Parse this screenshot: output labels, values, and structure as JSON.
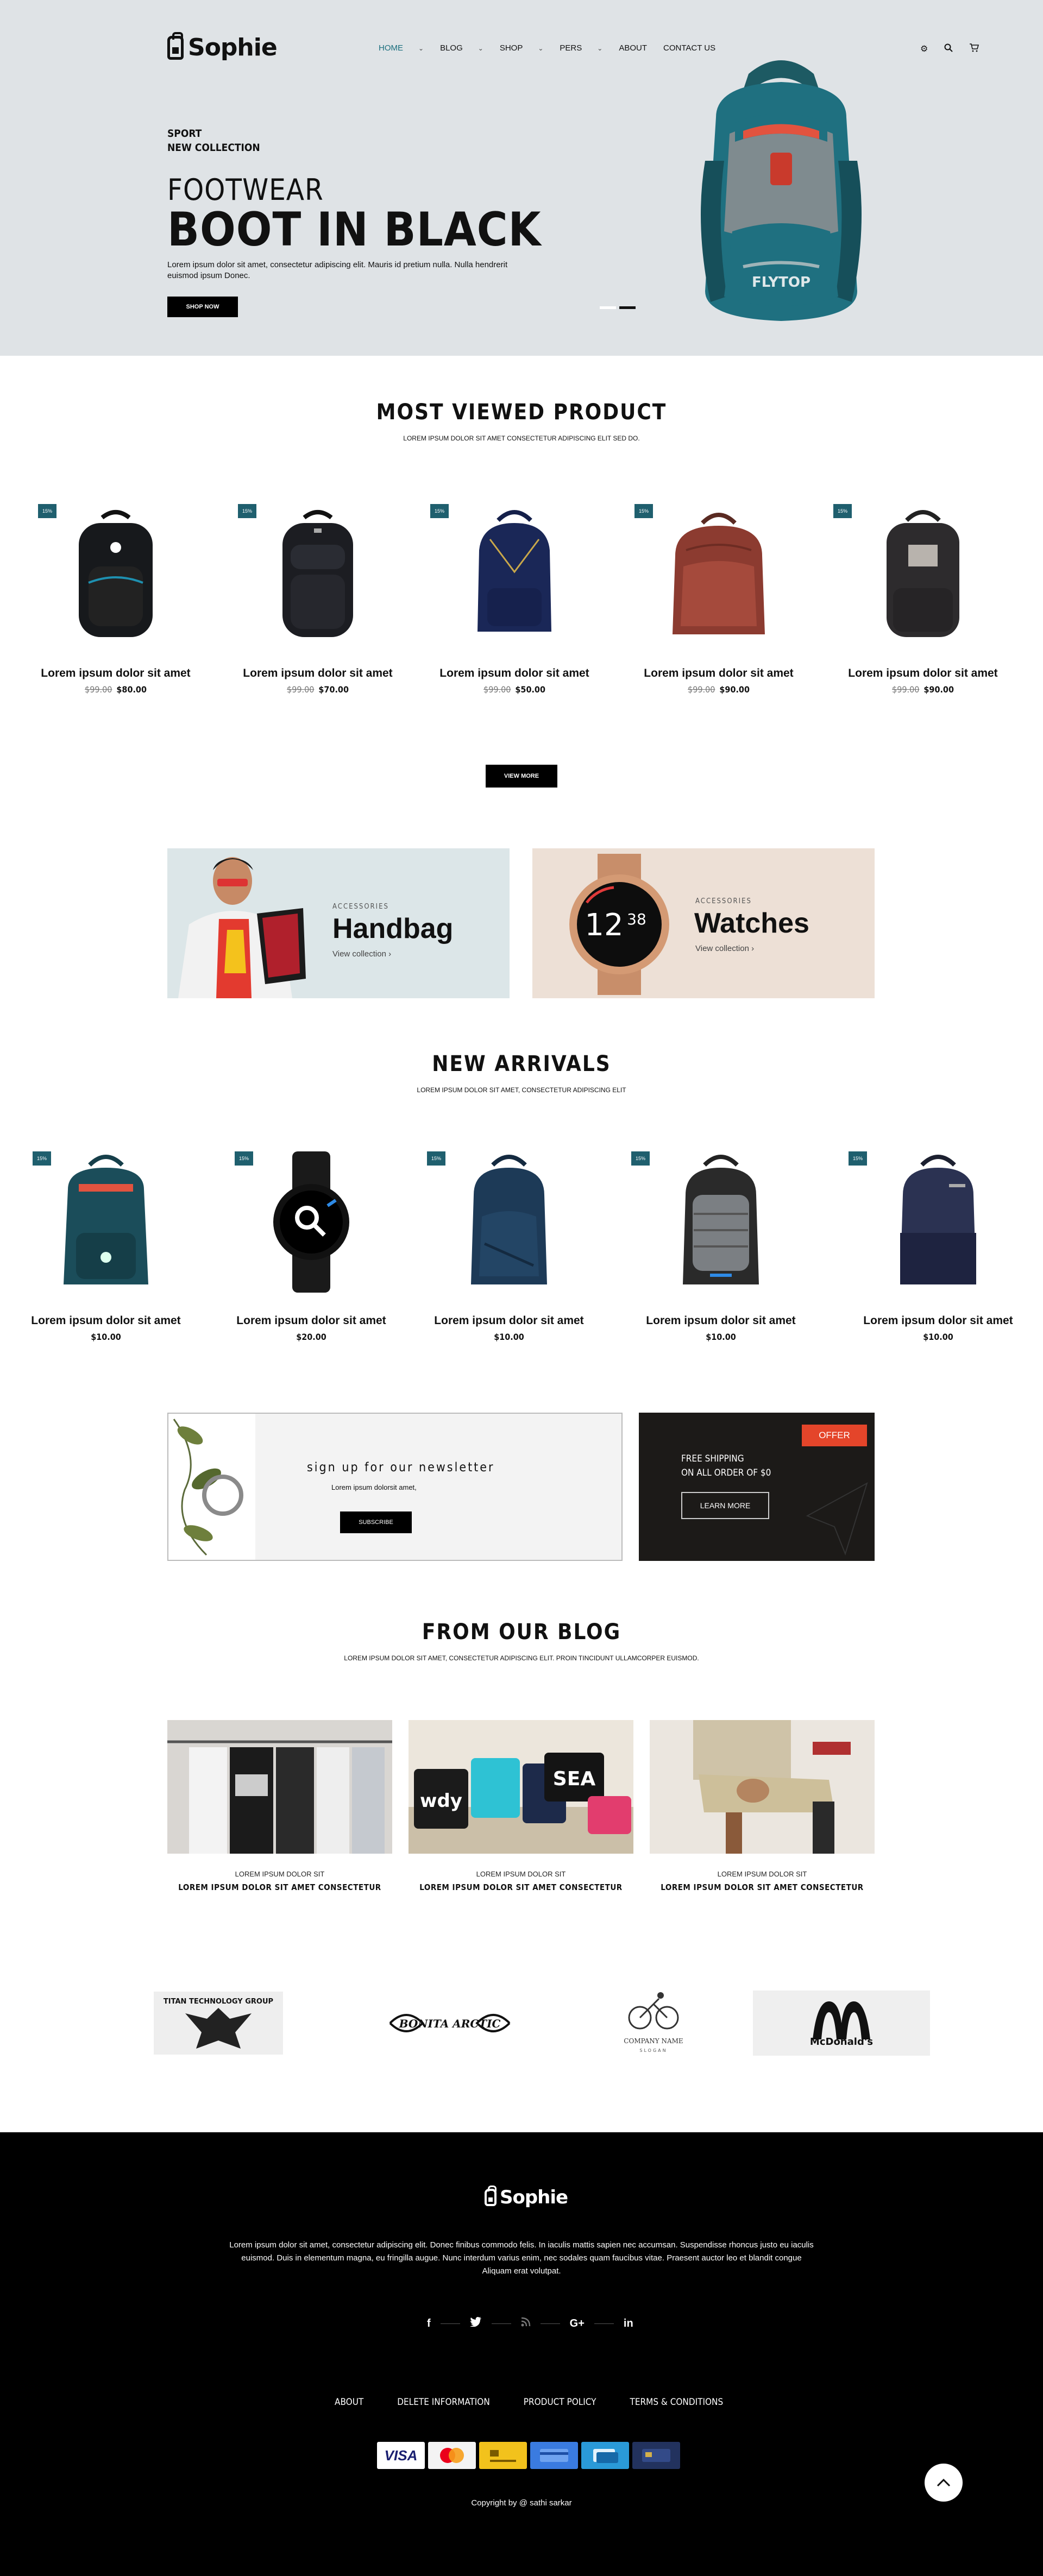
{
  "header": {
    "logo_text": "Sophie",
    "nav": [
      {
        "label": "Home",
        "active": true,
        "has_dropdown": true
      },
      {
        "label": "Blog",
        "has_dropdown": true
      },
      {
        "label": "Shop",
        "has_dropdown": true
      },
      {
        "label": "Pers",
        "has_dropdown": true
      },
      {
        "label": "About",
        "has_dropdown": false
      },
      {
        "label": "Contact Us",
        "has_dropdown": false
      }
    ],
    "icons": [
      "gear-icon",
      "search-icon",
      "cart-icon"
    ],
    "accent": "#1a6e7d"
  },
  "hero": {
    "sub1": "SPORT",
    "sub2": "NEW COLLECTION",
    "kicker": "FOOTWEAR",
    "title": "BOOT IN BLACK",
    "desc": "Lorem ipsum dolor sit amet, consectetur adipiscing elit. Mauris id pretium nulla. Nulla hendrerit euismod ipsum Donec.",
    "button": "SHOP NOW",
    "bag_brand": "FLYTOP",
    "slides": 2,
    "active_slide": 2
  },
  "most_viewed": {
    "title": "MOST  VIEWED PRODUCT",
    "subtitle": "LOREM IPSUM DOLOR SIT AMET CONSECTETUR ADIPISCING ELIT SED DO.",
    "products": [
      {
        "badge": "15%",
        "name": "Lorem ipsum dolor sit amet",
        "old": "$99.00",
        "price": "$80.00"
      },
      {
        "badge": "15%",
        "name": "Lorem ipsum dolor sit amet",
        "old": "$99.00",
        "price": "$70.00"
      },
      {
        "badge": "15%",
        "name": "Lorem ipsum dolor sit amet",
        "old": "$99.00",
        "price": "$50.00"
      },
      {
        "badge": "15%",
        "name": "Lorem ipsum dolor sit amet",
        "old": "$99.00",
        "price": "$90.00"
      },
      {
        "badge": "15%",
        "name": "Lorem ipsum dolor sit amet",
        "old": "$99.00",
        "price": "$90.00"
      }
    ],
    "view_more": "VIEW MORE"
  },
  "banners": [
    {
      "category": "ACCESSORIES",
      "title": "Handbag",
      "link": "View collection"
    },
    {
      "category": "ACCESSORIES",
      "title": "Watches",
      "link": "View collection",
      "watch_time": "12",
      "watch_min": "38"
    }
  ],
  "new_arrivals": {
    "title": "NEW ARRIVALS",
    "subtitle": "LOREM IPSUM DOLOR SIT AMET, CONSECTETUR ADIPISCING ELIT",
    "products": [
      {
        "badge": "15%",
        "name": "Lorem ipsum dolor sit amet",
        "price": "$10.00"
      },
      {
        "badge": "15%",
        "name": "Lorem ipsum dolor sit amet",
        "price": "$20.00"
      },
      {
        "badge": "15%",
        "name": "Lorem ipsum dolor sit amet",
        "price": "$10.00"
      },
      {
        "badge": "15%",
        "name": "Lorem ipsum dolor sit amet",
        "price": "$10.00"
      },
      {
        "badge": "15%",
        "name": "Lorem ipsum dolor sit amet",
        "price": "$10.00"
      }
    ]
  },
  "newsletter": {
    "title": "sign up for our newsletter",
    "text": "Lorem ipsum dolorsit amet,",
    "button": "SUBSCRIBE"
  },
  "offer": {
    "tag": "OFFER",
    "line1": "FREE SHIPPING",
    "line2": "ON ALL ORDER OF $0",
    "button": "LEARN MORE"
  },
  "blog": {
    "title": "FROM OUR BLOG",
    "subtitle": "LOREM IPSUM DOLOR SIT AMET, CONSECTETUR ADIPISCING ELIT. PROIN TINCIDUNT ULLAMCORPER EUISMOD.",
    "posts": [
      {
        "meta": "LOREM IPSUM DOLOR SIT",
        "title": "LOREM IPSUM DOLOR SIT AMET CONSECTETUR"
      },
      {
        "meta": "LOREM IPSUM DOLOR SIT",
        "title": "LOREM IPSUM DOLOR SIT AMET CONSECTETUR",
        "bag_text1": "wdy",
        "bag_text2": "SEA"
      },
      {
        "meta": "LOREM IPSUM DOLOR SIT",
        "title": "LOREM IPSUM DOLOR SIT AMET CONSECTETUR"
      }
    ]
  },
  "brands": [
    {
      "name": "TITAN TECHNOLOGY GROUP"
    },
    {
      "name": "BONITA ARCTIC"
    },
    {
      "name": "COMPANY NAME",
      "tagline": "SLOGAN"
    },
    {
      "name": "McDonald's"
    }
  ],
  "footer": {
    "logo_text": "Sophie",
    "desc": "Lorem ipsum dolor sit amet, consectetur adipiscing elit. Donec finibus commodo felis. In iaculis mattis sapien nec accumsan. Suspendisse rhoncus justo eu iaculis euismod. Duis in elementum magna, eu fringilla augue. Nunc interdum varius enim, nec sodales quam faucibus vitae. Praesent auctor leo et blandit congue Aliquam erat volutpat.",
    "social": [
      "facebook-icon",
      "twitter-icon",
      "rss-icon",
      "google-plus-icon",
      "linkedin-icon"
    ],
    "links": [
      "ABOUT",
      "DELETE INFORMATION",
      "PRODUCT POLICY",
      "TERMS & CONDITIONS"
    ],
    "payments": [
      "VISA",
      "mastercard",
      "payment-card",
      "card",
      "card",
      "card"
    ],
    "payment_visa": "VISA",
    "copyright": "Copyright by @ sathi sarkar"
  }
}
